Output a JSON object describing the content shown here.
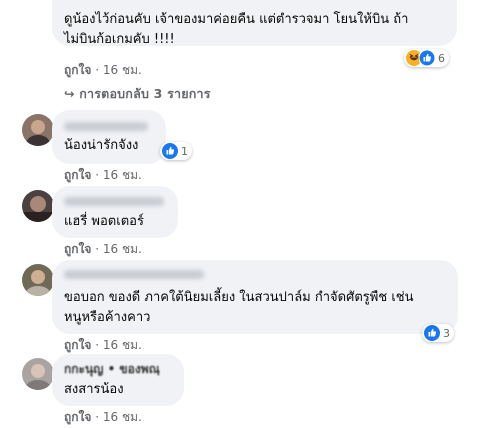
{
  "comments": [
    {
      "text_lines": [
        "ดูน้องไว้ก่อนคับ เจ้าของมาค่อยคืน แต่ตำรวจมา โยนให้บิน ถ้า",
        "ไม่บินก้อเกมคับ !!!!"
      ],
      "reaction_count": "6",
      "reactions": [
        "haha-icon",
        "like-icon"
      ],
      "like_label": "ถูกใจ",
      "time": "16 ชม."
    },
    {
      "text_lines": [
        "น้องน่ารักจังง"
      ],
      "reaction_count": "1",
      "reactions": [
        "like-icon"
      ],
      "like_label": "ถูกใจ",
      "time": "16 ชม."
    },
    {
      "text_lines": [
        "แฮรี่ พอตเตอร์"
      ],
      "like_label": "ถูกใจ",
      "time": "16 ชม."
    },
    {
      "text_lines": [
        "ขอบอก ของดี ภาคใต้นิยมเลี้ยง ในสวนปาล์ม กำจัดศัตรูพืช เช่น",
        "หนูหรือค้างคาว"
      ],
      "reaction_count": "3",
      "reactions": [
        "like-icon"
      ],
      "like_label": "ถูกใจ",
      "time": "16 ชม."
    },
    {
      "author": "กกะนุญ • ของพณฺ",
      "text_lines": [
        "สงสารน้อง"
      ],
      "like_label": "ถูกใจ",
      "time": "16 ชม."
    }
  ],
  "replies_toggle": {
    "arrow": "↪",
    "label": "การตอบกลับ 3 รายการ"
  },
  "separator": "·",
  "colors": {
    "bubble": "#f0f2f5",
    "meta": "#65676b",
    "like_blue": "#1877f2",
    "haha_yellow": "#f7b125"
  }
}
